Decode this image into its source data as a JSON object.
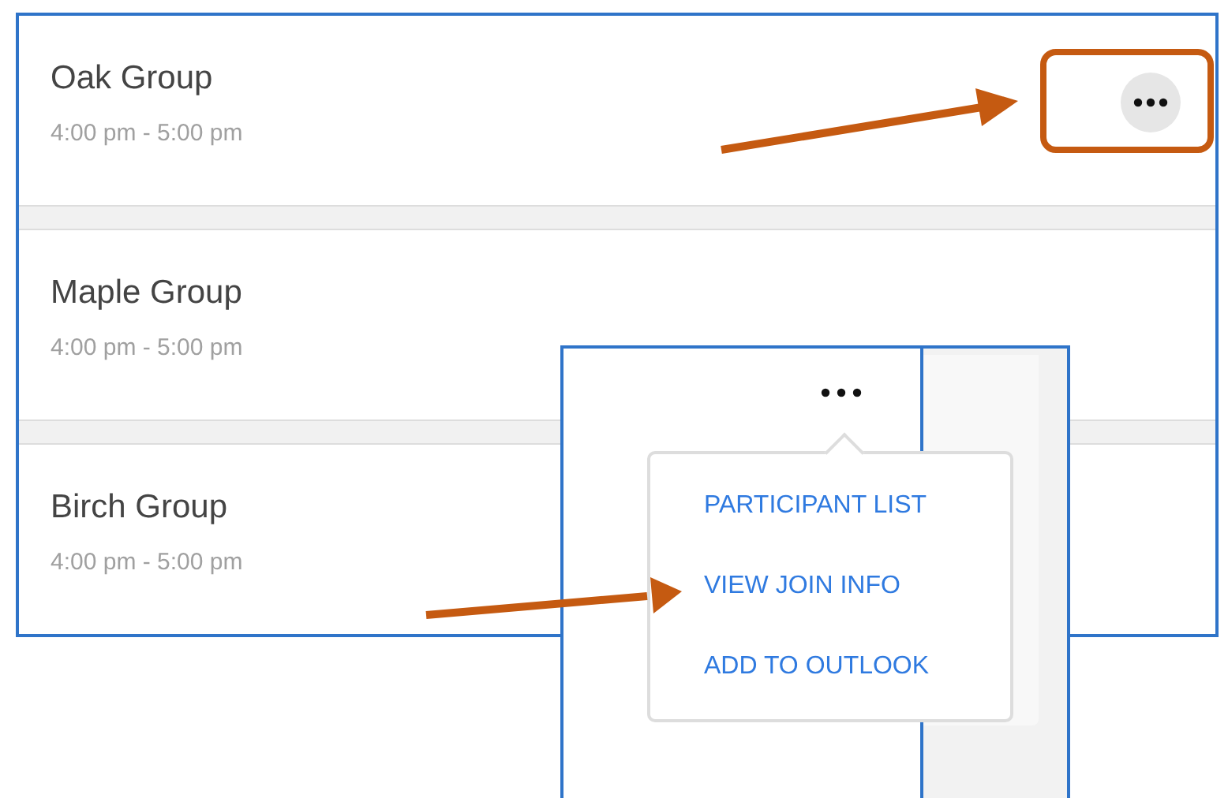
{
  "groups": [
    {
      "name": "Oak Group",
      "time": "4:00 pm - 5:00 pm"
    },
    {
      "name": "Maple Group",
      "time": "4:00 pm - 5:00 pm"
    },
    {
      "name": "Birch Group",
      "time": "4:00 pm - 5:00 pm"
    }
  ],
  "menu": {
    "items": [
      {
        "label": "PARTICIPANT LIST"
      },
      {
        "label": "VIEW JOIN INFO"
      },
      {
        "label": "ADD TO OUTLOOK"
      }
    ]
  }
}
